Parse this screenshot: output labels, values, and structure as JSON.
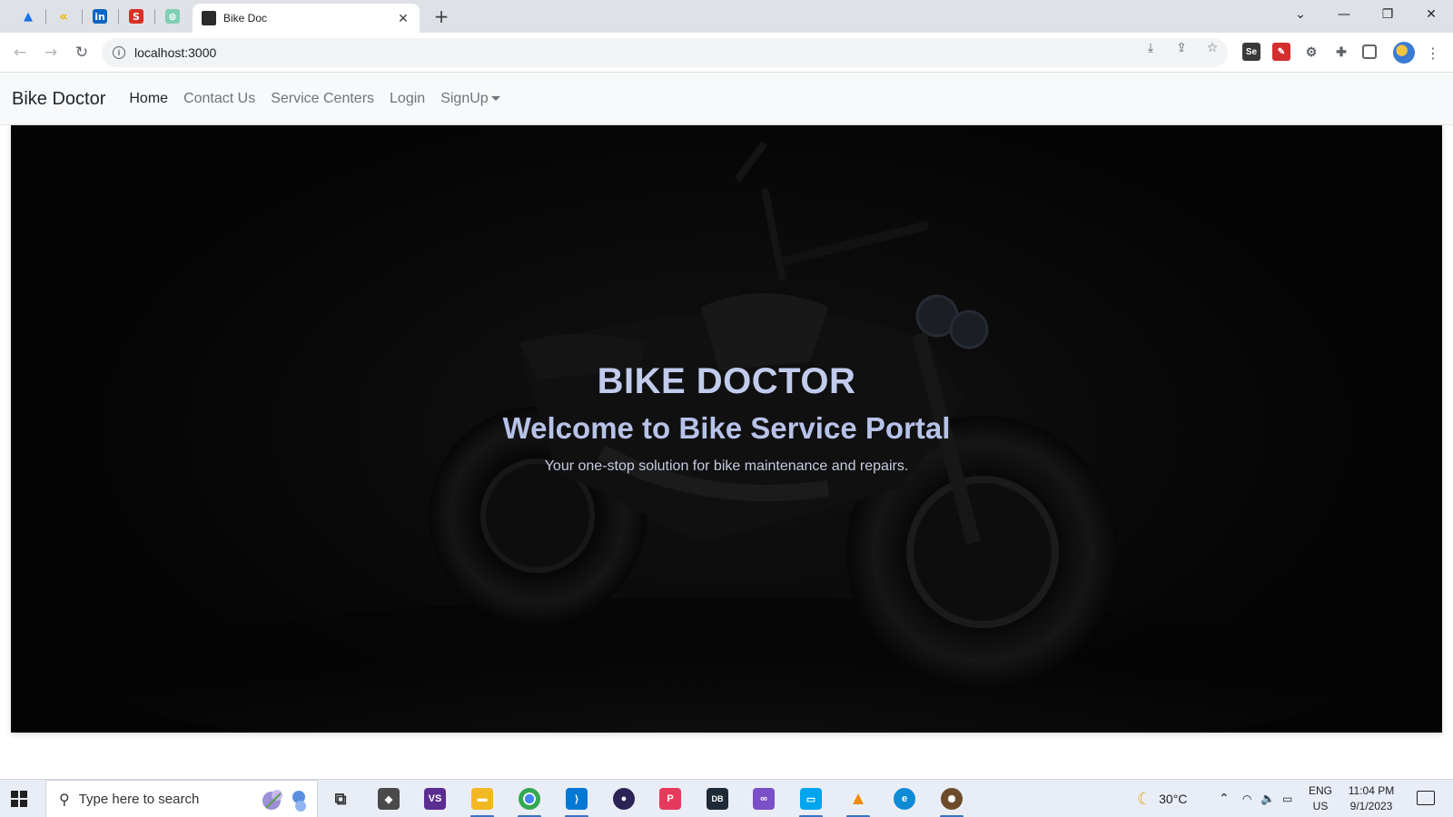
{
  "browser": {
    "pinned_tabs": [
      {
        "icon": "drive-icon",
        "color": "#1a73e8",
        "glyph": "▲"
      },
      {
        "icon": "app-icon",
        "color": "#f4b400",
        "glyph": "«"
      },
      {
        "icon": "linkedin-icon",
        "color": "#0a66c2",
        "glyph": "in"
      },
      {
        "icon": "s-app-icon",
        "color": "#d93025",
        "glyph": "S"
      },
      {
        "icon": "chatgpt-icon",
        "color": "#10a37f",
        "glyph": "⊛"
      }
    ],
    "active_tab_title": "Bike Doc",
    "url": "localhost:3000"
  },
  "site": {
    "brand": "Bike Doctor",
    "nav": {
      "home": "Home",
      "contact": "Contact Us",
      "service_centers": "Service Centers",
      "login": "Login",
      "signup": "SignUp"
    }
  },
  "hero": {
    "title": "BIKE DOCTOR",
    "subtitle": "Welcome to Bike Service Portal",
    "description": "Your one-stop solution for bike maintenance and repairs."
  },
  "taskbar": {
    "search_placeholder": "Type here to search",
    "weather_temp": "30°C",
    "lang_line1": "ENG",
    "lang_line2": "US",
    "time": "11:04 PM",
    "date": "9/1/2023",
    "apps": [
      {
        "name": "task-view-icon",
        "color": "#3c3c3c",
        "glyph": "⧉"
      },
      {
        "name": "unity-icon",
        "color": "#4a4a4a",
        "glyph": "◆"
      },
      {
        "name": "visual-studio-icon",
        "color": "#5c2d91",
        "glyph": "VS"
      },
      {
        "name": "file-explorer-icon",
        "color": "#f2b824",
        "glyph": "▬"
      },
      {
        "name": "chrome-icon",
        "color": "#34a853",
        "glyph": "◉"
      },
      {
        "name": "vscode-icon",
        "color": "#0078d4",
        "glyph": "⟩"
      },
      {
        "name": "eclipse-icon",
        "color": "#2c2255",
        "glyph": "●"
      },
      {
        "name": "postman-icon",
        "color": "#e63a5c",
        "glyph": "P"
      },
      {
        "name": "mysql-icon",
        "color": "#1f2a38",
        "glyph": "DB"
      },
      {
        "name": "vs-preview-icon",
        "color": "#7b4fc7",
        "glyph": "∞"
      },
      {
        "name": "remote-desktop-icon",
        "color": "#00a4ef",
        "glyph": "▭"
      },
      {
        "name": "vlc-icon",
        "color": "#f08a00",
        "glyph": "▲"
      },
      {
        "name": "edge-icon",
        "color": "#0f8bd6",
        "glyph": "e"
      },
      {
        "name": "app-extra-icon",
        "color": "#6b4b2a",
        "glyph": "✺"
      }
    ]
  }
}
